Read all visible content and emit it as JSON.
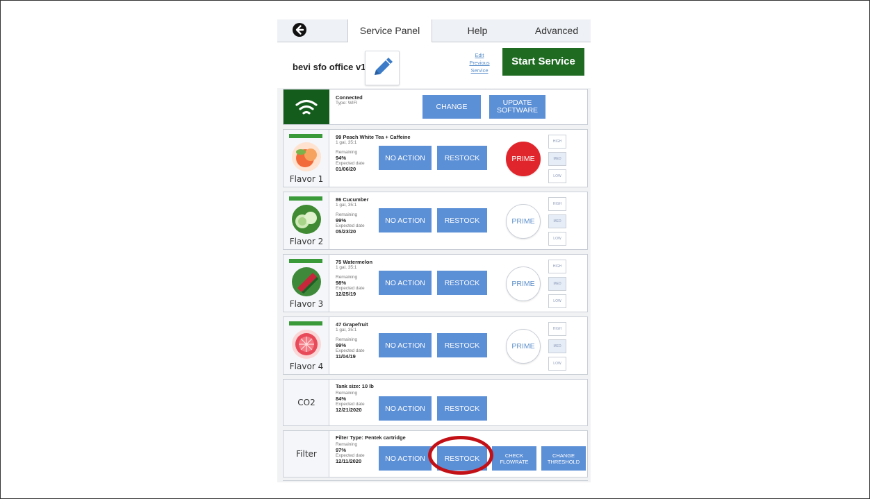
{
  "tabs": {
    "service": "Service Panel",
    "help": "Help",
    "advanced": "Advanced"
  },
  "header": {
    "device_name": "bevi sfo office v1",
    "edit_previous": "Edit Previous Service",
    "start_service": "Start Service"
  },
  "wifi": {
    "status": "Connected",
    "type": "Type: WIFI",
    "change": "CHANGE",
    "update": "UPDATE SOFTWARE"
  },
  "common": {
    "remaining_label": "Remaining",
    "expected_label": "Expected date",
    "no_action": "NO ACTION",
    "restock": "RESTOCK",
    "prime": "PRIME",
    "high": "HIGH",
    "med": "MED",
    "low": "LOW"
  },
  "flavors": [
    {
      "label": "Flavor 1",
      "name": "99 Peach White Tea + Caffeine",
      "size": "1 gal, 35:1",
      "remaining": "94%",
      "date": "01/06/20",
      "prime_active": true
    },
    {
      "label": "Flavor 2",
      "name": "86 Cucumber",
      "size": "1 gal, 35:1",
      "remaining": "99%",
      "date": "05/23/20",
      "prime_active": false
    },
    {
      "label": "Flavor 3",
      "name": "75 Watermelon",
      "size": "1 gal, 35:1",
      "remaining": "98%",
      "date": "12/25/19",
      "prime_active": false
    },
    {
      "label": "Flavor 4",
      "name": "47 Grapefruit",
      "size": "1 gal, 35:1",
      "remaining": "99%",
      "date": "11/04/19",
      "prime_active": false
    }
  ],
  "co2": {
    "label": "CO2",
    "tank": "Tank size: 10 lb",
    "remaining": "84%",
    "date": "12/21/2020"
  },
  "filter": {
    "label": "Filter",
    "type": "Filter Type: Pentek cartridge",
    "remaining": "97%",
    "date": "12/11/2020",
    "check_flowrate": "CHECK FLOWRATE",
    "change_threshold": "CHANGE THRESHOLD"
  },
  "colors": {
    "primary_button": "#5b8fd6",
    "start_service": "#1e6b21",
    "prime_active": "#e0262c",
    "highlight_ring": "#c21016",
    "wifi_bg": "#145c1b"
  }
}
